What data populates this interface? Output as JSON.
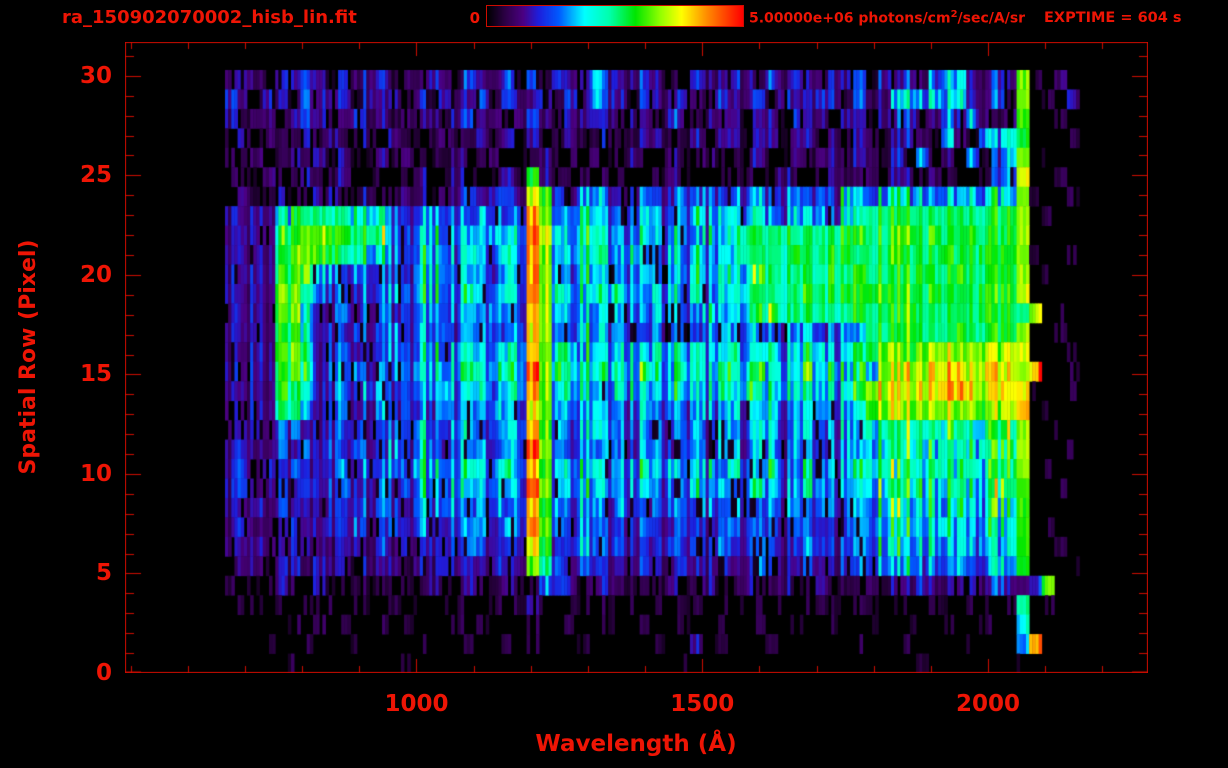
{
  "header": {
    "title": "ra_150902070002_hisb_lin.fit",
    "colorbar_min_label": "0",
    "colorbar_max_label_pre": "5.00000e+06 photons/cm",
    "colorbar_max_label_sup": "2",
    "colorbar_max_label_post": "/sec/A/sr",
    "exptime_label": "EXPTIME = 604 s"
  },
  "colors": {
    "background": "#000000",
    "annotation_red": "#ee1505",
    "frame_red": "#cf0c00",
    "colormap_stops": [
      [
        "0.00",
        "#000000"
      ],
      [
        "0.07",
        "#2d0046"
      ],
      [
        "0.14",
        "#4b0082"
      ],
      [
        "0.20",
        "#1e1edc"
      ],
      [
        "0.28",
        "#005aff"
      ],
      [
        "0.38",
        "#00ffff"
      ],
      [
        "0.48",
        "#00ffaa"
      ],
      [
        "0.58",
        "#00e600"
      ],
      [
        "0.68",
        "#96ff00"
      ],
      [
        "0.76",
        "#ffff00"
      ],
      [
        "0.86",
        "#ff8c00"
      ],
      [
        "1.00",
        "#ff0000"
      ]
    ]
  },
  "chart_data": {
    "type": "heatmap",
    "title": "ra_150902070002_hisb_lin.fit",
    "xlabel": "Wavelength (Å)",
    "ylabel": "Spatial Row (Pixel)",
    "x_tick_values": [
      1000,
      1500,
      2000
    ],
    "x_tick_labels": [
      "1000",
      "1500",
      "2000"
    ],
    "x_minor_tick_step": 100,
    "xlim": [
      490,
      2280
    ],
    "y_tick_values": [
      0,
      5,
      10,
      15,
      20,
      25,
      30
    ],
    "y_tick_labels": [
      "0",
      "5",
      "10",
      "15",
      "20",
      "25",
      "30"
    ],
    "y_minor_tick_step": 1,
    "ylim": [
      0,
      31.7
    ],
    "colorbar": {
      "min": 0,
      "max": 5000000,
      "units": "photons/cm²/sec/A/sr"
    },
    "exposure_time_s": 604,
    "grid": {
      "description": "Downsampled flux map. Hex levels 0-F per cell; flux = level/15 * 5.0e6 photons/cm²/sec/A/sr. Columns span wavelength_start..wavelength_end left to right; rows listed from spatial row 30 (top) to 0 (bottom). Bright vertical column near 1204 Å is geocoronal Lyman-alpha airglow; green hook feature spans 750-900 Å rows 13-23; broad green/yellow continuum 870-2060 Å; bright detector edge column near 2065 Å.",
      "wavelength_start": 665,
      "wavelength_end": 2160,
      "n_cols": 68,
      "row_min": 0,
      "row_max": 30,
      "rows_top_to_bottom": [
        "232132321323312232132231313226322321132232132322323132325663232C1020",
        "321321322313221313223132231325321322321322313223313225657563231C0102",
        "212212321232212221232212321223212213212221221322122123322535212B0010",
        "121211212112121112112121211211211221121221221221212212321621546A0001",
        "112112121211212111211211121202112112112111211212212213161215135C0100",
        "111211211201101211210121921110110112101111012101211212212110134D0010",
        "121121122112112212232332BA32553234334343434344343545565656565 65C1001",
        "223267888877643554434434DB44764445444545545445444559999999999 99C0100",
        "223279AAAA99744664544545EC54764445454454688898889999 9AA9A99A999C0010",
        "22328AA99887544664454454DB44765454454545588889889989 9A999A99A99C1001",
        "2232997443443436644443 44DB437544454445455678888898999 99A99A9999C0100",
        "2232AA63343434466445 4454EB54665554554545568888989 99AA9A9A999A99D0011",
        "2232AA52343343465444454 4DB44654444544454556788888899 99A99999A999C0100",
        "223299523343343644344434CB43654443444344444344434449 99A999A9999C0010",
        "2232AA62343434466455455 5DB65665555655655655655 65556ABBABCCBCCBCD0101",
        "223299623443444665565565EB65665556556556656555 656566BBCCDDDCDCCCE0010",
        "2232985234344345554554 55DB55654555565556565565555 56CCCCDDEEDCCCE1001",
        "223288423433434545444544CB445544454544545445454 5455BBCBCCCBCBBCF0100",
        "2232332233433436434434 44DA4355433443443443443443444788788787787C0010",
        "2322323233433436434443 44EB4354433443443443443443444778777877877C0001",
        "2323232234343447544544 54CA4465444545445454454454445787878778787C0100",
        "2322323234334346445445 44EB4465444544454544544454444778777787778B0010",
        "2232322233434336444344 34DA4355344344434444344434444677677677676B0001",
        "2322232233433335434443 44EB4354333433433443343433344667666766766B0100",
        "2232232223323233333433 33CA3364333334333433433343334566566565656B0010",
        "1221221222122213232223 22A83243222322322322322232233454545454454A0001",
        "111121121111111121121 1211432122111121121121121121112122 3222323223A0000",
        "0110101110110101011011012101101010101101011010111011011111011 0190100",
        "001001010100101000101001100100100100100100100100100100100100 10070000",
        "000100100010000100010010100010000010020100010000001000100001 0006F010",
        "000001000000001000000000010000000000100000000010000000 0100000 0010000"
      ]
    }
  }
}
